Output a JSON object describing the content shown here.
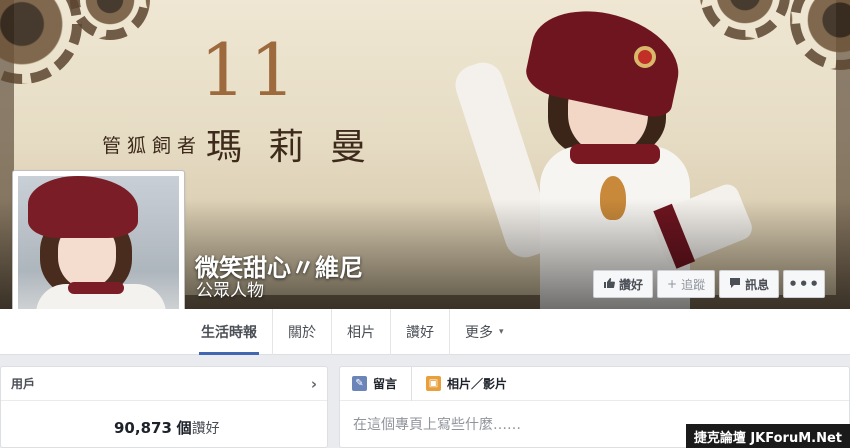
{
  "cover": {
    "number": "11",
    "tagline_small": "管狐飼者",
    "tagline_big": "瑪莉曼"
  },
  "page": {
    "name": "微笑甜心〃維尼",
    "category": "公眾人物"
  },
  "actions": {
    "like": "讚好",
    "follow": "追蹤",
    "message": "訊息",
    "more": "•••"
  },
  "tabs": [
    {
      "label": "生活時報",
      "active": true
    },
    {
      "label": "關於"
    },
    {
      "label": "相片"
    },
    {
      "label": "讚好"
    },
    {
      "label": "更多",
      "caret": "▾"
    }
  ],
  "left_card": {
    "title": "用戶",
    "likes_number": "90,873",
    "likes_unit": "個",
    "likes_word": "讚好"
  },
  "composer": {
    "post_tab": "留言",
    "photo_tab": "相片／影片",
    "placeholder": "在這個專頁上寫些什麼……"
  },
  "watermark": "捷克論壇 JKForuM.Net",
  "icons": {
    "like": "thumbs-up-icon",
    "follow": "plus-icon",
    "message": "chat-bubble-icon",
    "left_chevron": "chevron-right-icon",
    "post": "pencil-icon",
    "photo": "photo-icon"
  },
  "colors": {
    "accent": "#4267b2",
    "page_bg": "#e9ebee",
    "cover_number": "#9d6a3e"
  }
}
